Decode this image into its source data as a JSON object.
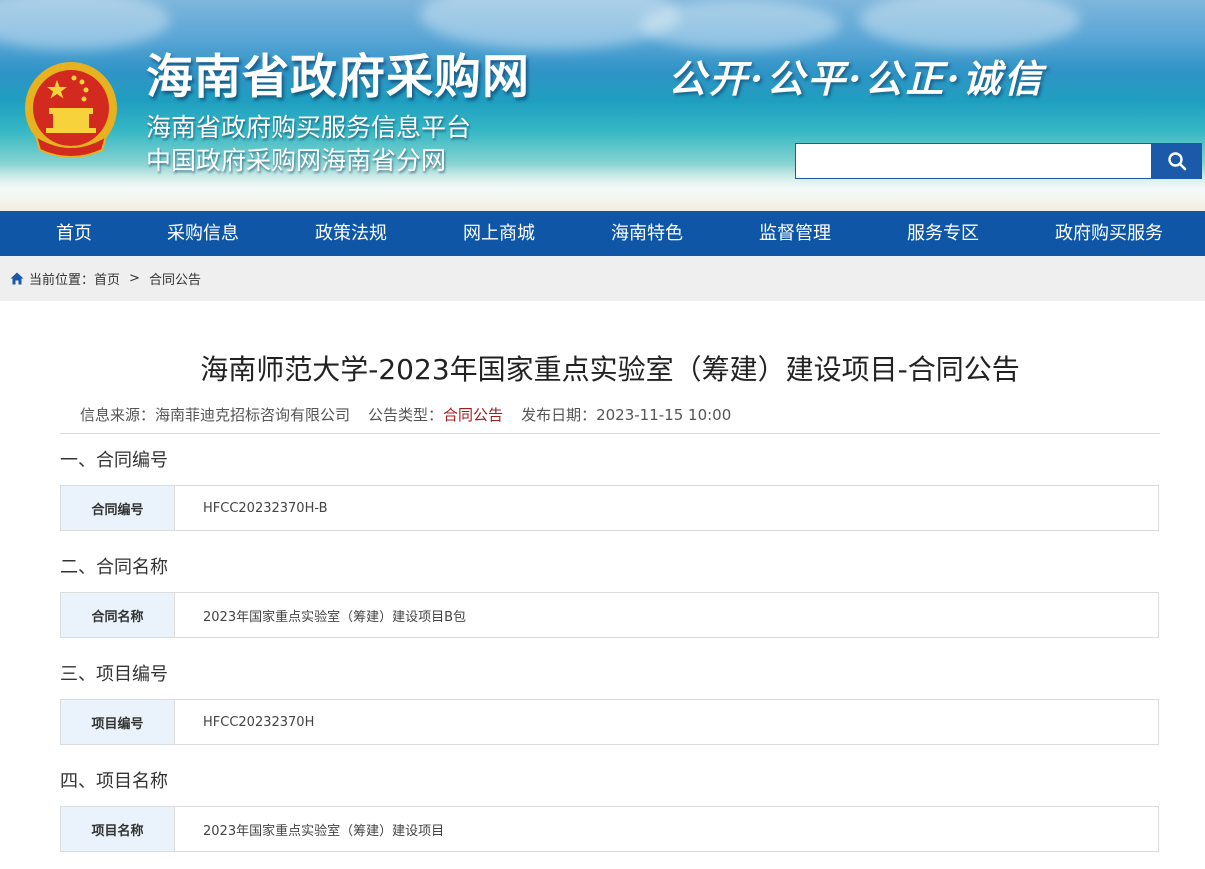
{
  "header": {
    "site_title": "海南省政府采购网",
    "subtitle_1": "海南省政府购买服务信息平台",
    "subtitle_2": "中国政府采购网海南省分网",
    "motto": "公开·公平·公正·诚信",
    "search_placeholder": ""
  },
  "nav": {
    "items": [
      "首页",
      "采购信息",
      "政策法规",
      "网上商城",
      "海南特色",
      "监督管理",
      "服务专区",
      "政府购买服务"
    ]
  },
  "breadcrumb": {
    "prefix": "当前位置：",
    "home": "首页",
    "separator": ">",
    "current": "合同公告"
  },
  "article": {
    "title": "海南师范大学-2023年国家重点实验室（筹建）建设项目-合同公告",
    "meta": {
      "source_label": "信息来源：",
      "source_value": "海南菲迪克招标咨询有限公司",
      "type_label": "公告类型：",
      "type_value": "合同公告",
      "date_label": "发布日期：",
      "date_value": "2023-11-15 10:00"
    },
    "sections": [
      {
        "heading": "一、合同编号",
        "key": "合同编号",
        "value": "HFCC20232370H-B"
      },
      {
        "heading": "二、合同名称",
        "key": "合同名称",
        "value": "2023年国家重点实验室（筹建）建设项目B包"
      },
      {
        "heading": "三、项目编号",
        "key": "项目编号",
        "value": "HFCC20232370H"
      },
      {
        "heading": "四、项目名称",
        "key": "项目名称",
        "value": "2023年国家重点实验室（筹建）建设项目"
      }
    ]
  },
  "colors": {
    "nav_bg": "#0f57a6",
    "type_value": "#a01c1c",
    "key_cell_bg": "#eaf3fb"
  },
  "icons": {
    "emblem": "national-emblem-icon",
    "search": "search-icon",
    "home": "home-icon"
  }
}
